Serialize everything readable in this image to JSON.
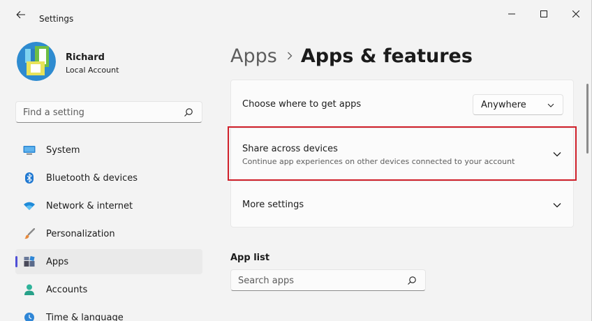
{
  "window": {
    "title": "Settings"
  },
  "profile": {
    "name": "Richard",
    "account_type": "Local Account"
  },
  "sidebar_search": {
    "placeholder": "Find a setting",
    "icon": "search-icon"
  },
  "nav": {
    "items": [
      {
        "label": "System",
        "icon": "system-icon",
        "active": false
      },
      {
        "label": "Bluetooth & devices",
        "icon": "bluetooth-icon",
        "active": false
      },
      {
        "label": "Network & internet",
        "icon": "wifi-icon",
        "active": false
      },
      {
        "label": "Personalization",
        "icon": "brush-icon",
        "active": false
      },
      {
        "label": "Apps",
        "icon": "apps-icon",
        "active": true
      },
      {
        "label": "Accounts",
        "icon": "accounts-icon",
        "active": false
      },
      {
        "label": "Time & language",
        "icon": "time-language-icon",
        "active": false
      }
    ]
  },
  "breadcrumb": {
    "parent": "Apps",
    "current": "Apps & features"
  },
  "settings": {
    "get_apps": {
      "title": "Choose where to get apps",
      "dropdown_value": "Anywhere"
    },
    "share": {
      "title": "Share across devices",
      "description": "Continue app experiences on other devices connected to your account"
    },
    "more": {
      "title": "More settings"
    }
  },
  "app_list": {
    "heading": "App list",
    "search_placeholder": "Search apps"
  },
  "colors": {
    "accent": "#4f4fd6",
    "highlight": "#d0202a",
    "background": "#f3f3f3",
    "card": "#fbfbfb"
  }
}
